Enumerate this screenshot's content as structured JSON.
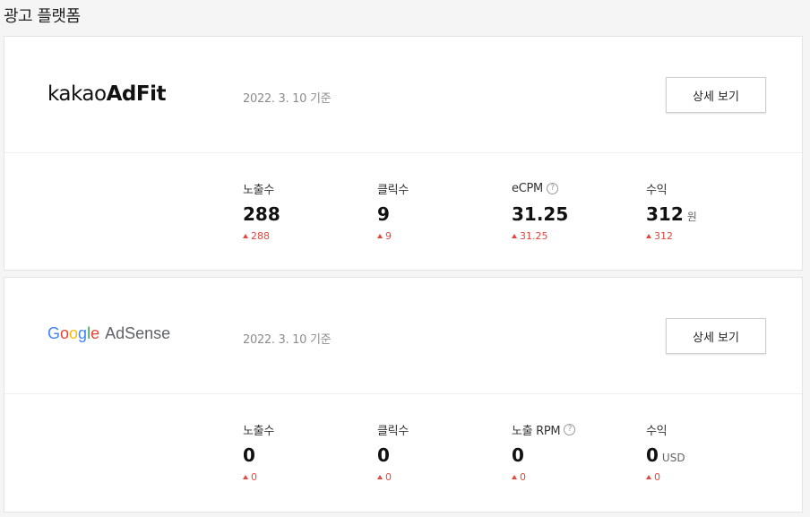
{
  "page": {
    "title": "광고 플랫폼"
  },
  "platforms": [
    {
      "logo": {
        "light": "kakao",
        "bold": "AdFit"
      },
      "date": "2022. 3. 10 기준",
      "detail_label": "상세 보기",
      "stats": [
        {
          "label": "노출수",
          "value": "288",
          "unit": "",
          "change": "288",
          "help": false
        },
        {
          "label": "클릭수",
          "value": "9",
          "unit": "",
          "change": "9",
          "help": false
        },
        {
          "label": "eCPM",
          "value": "31.25",
          "unit": "",
          "change": "31.25",
          "help": true
        },
        {
          "label": "수익",
          "value": "312",
          "unit": "원",
          "change": "312",
          "help": false
        }
      ]
    },
    {
      "logo": {
        "google": [
          "G",
          "o",
          "o",
          "g",
          "l",
          "e"
        ],
        "google_colors": [
          "#4285F4",
          "#EA4335",
          "#FBBC05",
          "#4285F4",
          "#34A853",
          "#EA4335"
        ],
        "product": "AdSense"
      },
      "date": "2022. 3. 10 기준",
      "detail_label": "상세 보기",
      "stats": [
        {
          "label": "노출수",
          "value": "0",
          "unit": "",
          "change": "0",
          "help": false
        },
        {
          "label": "클릭수",
          "value": "0",
          "unit": "",
          "change": "0",
          "help": false
        },
        {
          "label": "노출 RPM",
          "value": "0",
          "unit": "",
          "change": "0",
          "help": true
        },
        {
          "label": "수익",
          "value": "0",
          "unit": "USD",
          "change": "0",
          "help": false
        }
      ]
    }
  ],
  "icons": {
    "help": "question-circle-icon",
    "change": "triangle-up-icon",
    "help_glyph": "?"
  },
  "colors": {
    "increase": "#e5463d"
  }
}
